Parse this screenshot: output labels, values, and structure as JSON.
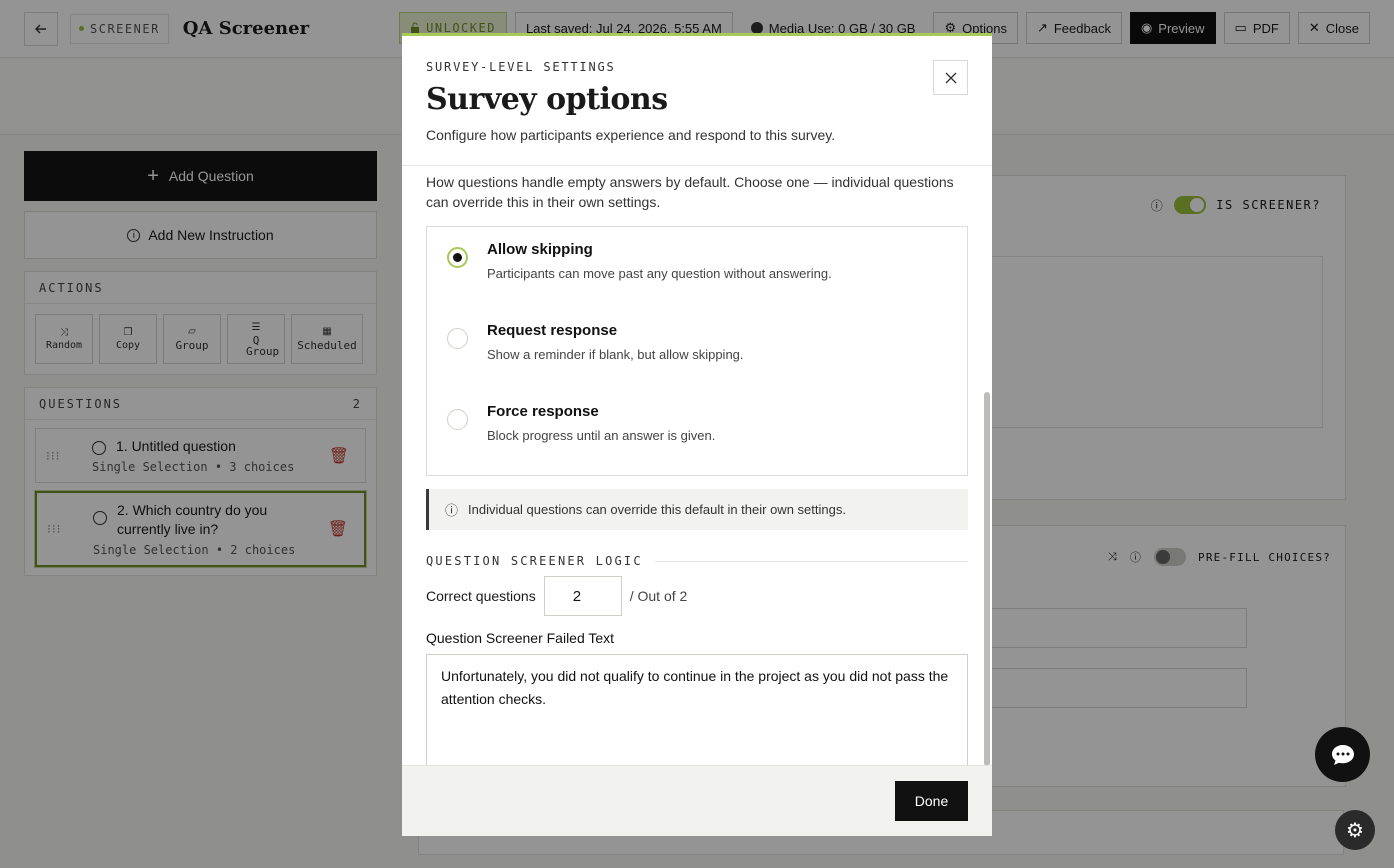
{
  "header": {
    "tag": "SCREENER",
    "title": "QA Screener",
    "unlocked_label": "UNLOCKED",
    "last_saved": "Last saved: Jul 24, 2026, 5:55 AM",
    "media_use": "Media Use: 0 GB / 30 GB",
    "options_label": "Options",
    "feedback_label": "Feedback",
    "preview_label": "Preview",
    "pdf_label": "PDF",
    "close_label": "Close"
  },
  "left": {
    "add_question": "Add Question",
    "add_instruction": "Add New Instruction",
    "actions_title": "ACTIONS",
    "actions": [
      {
        "icon": "shuffle-icon",
        "label": "Random"
      },
      {
        "icon": "copy-icon",
        "label": "Copy"
      },
      {
        "icon": "folder-icon",
        "label": "Group"
      },
      {
        "icon": "list-check-icon",
        "label": "Q Group"
      },
      {
        "icon": "calendar-icon",
        "label": "Scheduled"
      }
    ],
    "questions_title": "QUESTIONS",
    "questions_count": "2",
    "questions": [
      {
        "title": "1. Untitled question",
        "sub": "Single Selection • 3 choices",
        "active": false
      },
      {
        "title": "2. Which country do you currently live in?",
        "sub": "Single Selection • 2 choices",
        "active": true
      }
    ]
  },
  "right": {
    "is_screener_label": "IS SCREENER?",
    "prefill_label": "PRE-FILL CHOICES?"
  },
  "modal": {
    "eyebrow": "SURVEY-LEVEL SETTINGS",
    "title": "Survey options",
    "subtitle": "Configure how participants experience and respond to this survey.",
    "description": "How questions handle empty answers by default. Choose one — individual questions can override this in their own settings.",
    "options": [
      {
        "title": "Allow skipping",
        "desc": "Participants can move past any question without answering.",
        "selected": true
      },
      {
        "title": "Request response",
        "desc": "Show a reminder if blank, but allow skipping.",
        "selected": false
      },
      {
        "title": "Force response",
        "desc": "Block progress until an answer is given.",
        "selected": false
      }
    ],
    "info_note": "Individual questions can override this default in their own settings.",
    "logic_title": "QUESTION SCREENER LOGIC",
    "correct_label": "Correct questions",
    "correct_value": "2",
    "out_of": "/ Out of 2",
    "failed_label": "Question Screener Failed Text",
    "failed_text": "Unfortunately, you did not qualify to continue in the project as you did not pass the attention checks.",
    "done_label": "Done"
  },
  "colors": {
    "accent": "#a7c957",
    "accent_dark": "#6f8e2c",
    "danger": "#c0392b"
  }
}
